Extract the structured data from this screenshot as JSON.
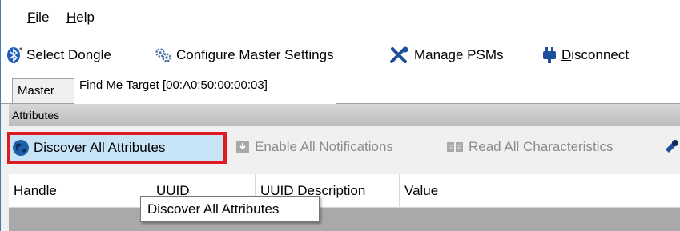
{
  "menubar": {
    "items": [
      {
        "label": "File",
        "accel": "F",
        "rest": "ile"
      },
      {
        "label": "Help",
        "accel": "H",
        "rest": "elp"
      }
    ]
  },
  "toolbar": {
    "select_dongle": "Select Dongle",
    "configure_master": "Configure Master Settings",
    "manage_psms": "Manage PSMs",
    "disconnect_accel": "D",
    "disconnect_rest": "isconnect"
  },
  "tabs": [
    {
      "label": "Master",
      "active": false
    },
    {
      "label": "Find Me Target [00:A0:50:00:00:03]",
      "active": true
    }
  ],
  "panel": {
    "title": "Attributes"
  },
  "attr_toolbar": {
    "discover_all": "Discover All Attributes",
    "enable_notifications": "Enable All Notifications",
    "read_characteristics": "Read All Characteristics"
  },
  "grid": {
    "columns": [
      "Handle",
      "UUID",
      "UUID Description",
      "Value"
    ]
  },
  "tooltip": {
    "text": "Discover All Attributes"
  },
  "colors": {
    "highlight_outline": "#e01a22",
    "highlight_fill": "#c7e4f7",
    "bluetooth_blue": "#1d5fbf",
    "disabled_text": "#8b8b8b"
  },
  "icons": {
    "select_dongle": "bluetooth-icon",
    "configure_master": "gears-icon",
    "manage_psms": "tools-icon",
    "disconnect": "plug-icon",
    "discover_all": "globe-icon",
    "enable_notifications": "notification-icon",
    "read_characteristics": "book-icon"
  }
}
